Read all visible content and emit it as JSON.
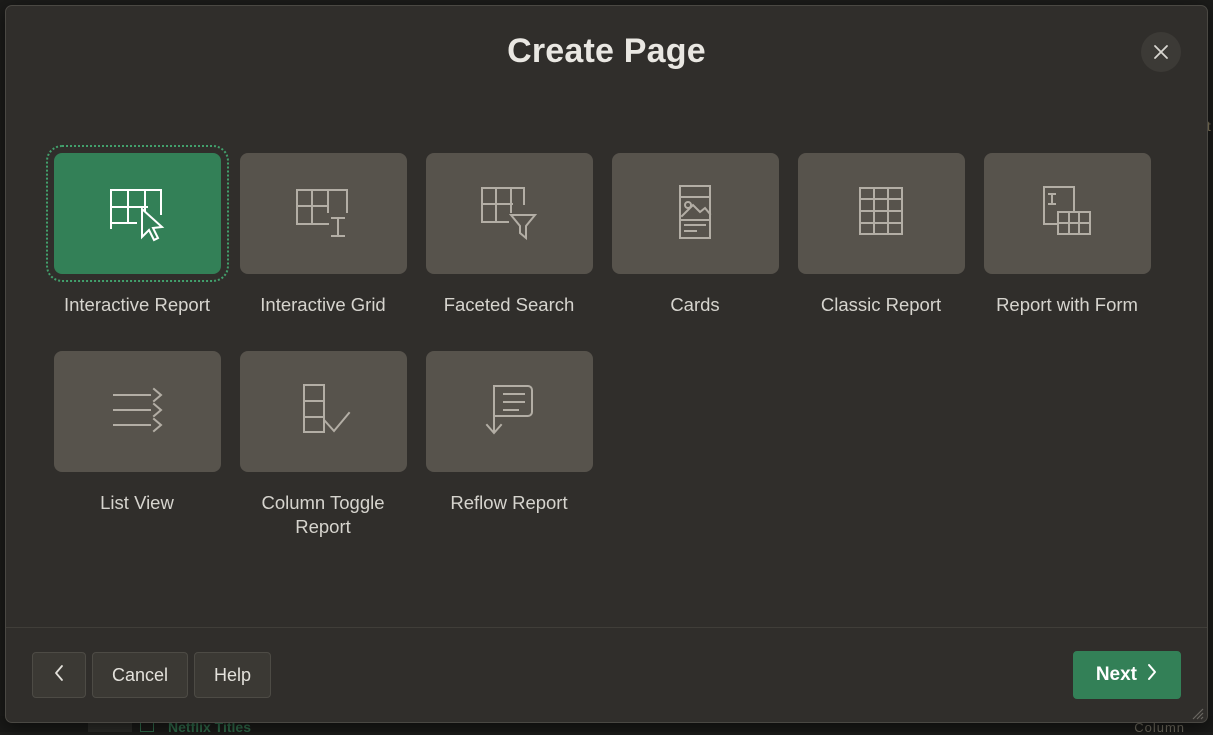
{
  "background": {
    "right_edge_text": "t",
    "bottom_label": "Netflix Titles",
    "bottom_right_text": "Column"
  },
  "dialog": {
    "title": "Create Page",
    "close_icon": "close-icon",
    "close_label": "Close"
  },
  "colors": {
    "accent_green": "#338057",
    "tile_grey": "#57534c",
    "dialog_bg": "#302e2b",
    "label_text": "#d6d4ce"
  },
  "page_types": [
    {
      "label": "Interactive Report",
      "icon": "grid-with-cursor-icon",
      "selected": true
    },
    {
      "label": "Interactive Grid",
      "icon": "grid-with-text-cursor-icon",
      "selected": false
    },
    {
      "label": "Faceted Search",
      "icon": "grid-with-funnel-icon",
      "selected": false
    },
    {
      "label": "Cards",
      "icon": "card-with-image-icon",
      "selected": false
    },
    {
      "label": "Classic Report",
      "icon": "table-grid-icon",
      "selected": false
    },
    {
      "label": "Report with Form",
      "icon": "form-with-table-icon",
      "selected": false
    },
    {
      "label": "List View",
      "icon": "list-with-chevrons-icon",
      "selected": false
    },
    {
      "label": "Column Toggle Report",
      "icon": "column-with-check-icon",
      "selected": false
    },
    {
      "label": "Reflow Report",
      "icon": "reflow-arrow-icon",
      "selected": false
    }
  ],
  "footer": {
    "back_label": "",
    "back_icon": "chevron-left-icon",
    "cancel_label": "Cancel",
    "help_label": "Help",
    "next_label": "Next",
    "next_icon": "chevron-right-icon"
  }
}
